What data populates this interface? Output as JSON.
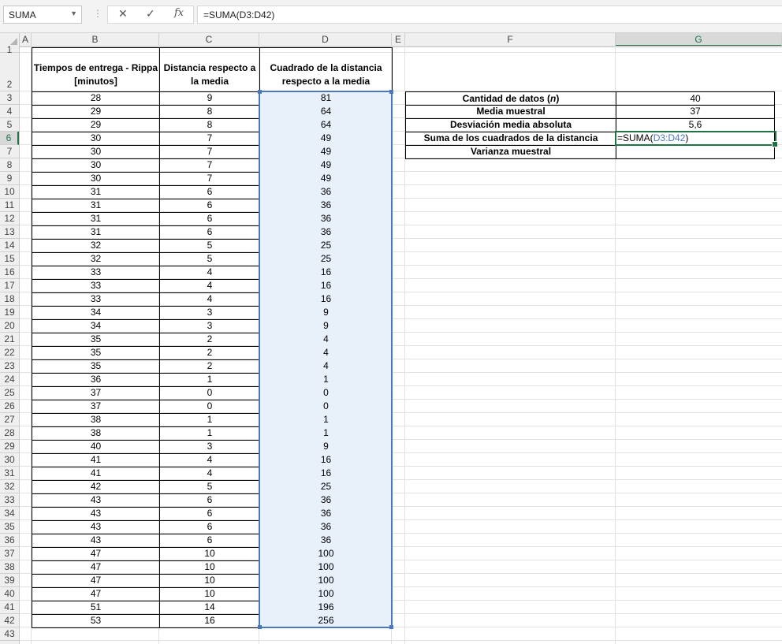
{
  "formula_bar": {
    "name_box": "SUMA",
    "formula": "=SUMA(D3:D42)"
  },
  "columns": [
    "A",
    "B",
    "C",
    "D",
    "E",
    "F",
    "G"
  ],
  "active_column": "G",
  "active_row": "6",
  "table": {
    "headers": {
      "b": "Tiempos de entrega - Rippa [minutos]",
      "c": "Distancia respecto a la media",
      "d": "Cuadrado de la distancia respecto a la media"
    },
    "rows": [
      [
        "28",
        "9",
        "81"
      ],
      [
        "29",
        "8",
        "64"
      ],
      [
        "29",
        "8",
        "64"
      ],
      [
        "30",
        "7",
        "49"
      ],
      [
        "30",
        "7",
        "49"
      ],
      [
        "30",
        "7",
        "49"
      ],
      [
        "30",
        "7",
        "49"
      ],
      [
        "31",
        "6",
        "36"
      ],
      [
        "31",
        "6",
        "36"
      ],
      [
        "31",
        "6",
        "36"
      ],
      [
        "31",
        "6",
        "36"
      ],
      [
        "32",
        "5",
        "25"
      ],
      [
        "32",
        "5",
        "25"
      ],
      [
        "33",
        "4",
        "16"
      ],
      [
        "33",
        "4",
        "16"
      ],
      [
        "33",
        "4",
        "16"
      ],
      [
        "34",
        "3",
        "9"
      ],
      [
        "34",
        "3",
        "9"
      ],
      [
        "35",
        "2",
        "4"
      ],
      [
        "35",
        "2",
        "4"
      ],
      [
        "35",
        "2",
        "4"
      ],
      [
        "36",
        "1",
        "1"
      ],
      [
        "37",
        "0",
        "0"
      ],
      [
        "37",
        "0",
        "0"
      ],
      [
        "38",
        "1",
        "1"
      ],
      [
        "38",
        "1",
        "1"
      ],
      [
        "40",
        "3",
        "9"
      ],
      [
        "41",
        "4",
        "16"
      ],
      [
        "41",
        "4",
        "16"
      ],
      [
        "42",
        "5",
        "25"
      ],
      [
        "43",
        "6",
        "36"
      ],
      [
        "43",
        "6",
        "36"
      ],
      [
        "43",
        "6",
        "36"
      ],
      [
        "43",
        "6",
        "36"
      ],
      [
        "47",
        "10",
        "100"
      ],
      [
        "47",
        "10",
        "100"
      ],
      [
        "47",
        "10",
        "100"
      ],
      [
        "47",
        "10",
        "100"
      ],
      [
        "51",
        "14",
        "196"
      ],
      [
        "53",
        "16",
        "256"
      ]
    ]
  },
  "summary": [
    {
      "label_prefix": "Cantidad de datos (",
      "label_italic": "n",
      "label_suffix": ")",
      "value": "40"
    },
    {
      "label_prefix": "Media muestral",
      "label_italic": "",
      "label_suffix": "",
      "value": "37"
    },
    {
      "label_prefix": "Desviación media absoluta",
      "label_italic": "",
      "label_suffix": "",
      "value": "5,6"
    },
    {
      "label_prefix": "Suma de los cuadrados de la distancia",
      "label_italic": "",
      "label_suffix": "",
      "value": ""
    },
    {
      "label_prefix": "Varianza muestral",
      "label_italic": "",
      "label_suffix": "",
      "value": ""
    }
  ],
  "editing": {
    "prefix": "=SUMA(",
    "ref": "D3:D42",
    "suffix": ")"
  },
  "colors": {
    "accent": "#217346",
    "range_highlight": "#4b77be",
    "range_fill": "#e8f0fa"
  }
}
